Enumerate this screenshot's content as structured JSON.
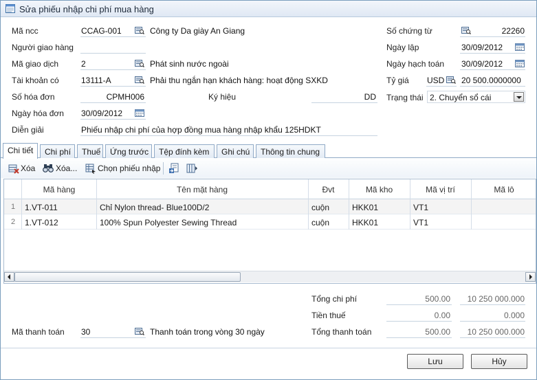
{
  "window": {
    "title": "Sửa phiếu nhập chi phí mua hàng"
  },
  "form": {
    "supplier_code_label": "Mã ncc",
    "supplier_code": "CCAG-001",
    "supplier_name": "Công ty Da giày An Giang",
    "deliverer_label": "Người giao hàng",
    "deliverer": "",
    "transaction_code_label": "Mã giao dịch",
    "transaction_code": "2",
    "transaction_name": "Phát sinh nước ngoài",
    "credit_account_label": "Tài khoản có",
    "credit_account": "13111-A",
    "credit_account_name": "Phải thu ngắn hạn khách hàng: hoạt động SXKD",
    "invoice_no_label": "Số hóa đơn",
    "invoice_no": "CPMH006",
    "symbol_label": "Ký hiệu",
    "symbol": "DD",
    "invoice_date_label": "Ngày hóa đơn",
    "invoice_date": "30/09/2012",
    "description_label": "Diễn giải",
    "description": "Phiếu nhập chi phí của hợp đồng mua hàng nhập khẩu 125HDKT",
    "voucher_no_label": "Số chứng từ",
    "voucher_no": "22260",
    "created_date_label": "Ngày lập",
    "created_date": "30/09/2012",
    "posting_date_label": "Ngày hạch toán",
    "posting_date": "30/09/2012",
    "exchange_rate_label": "Tỷ giá",
    "currency": "USD",
    "exchange_rate": "20 500.0000000",
    "status_label": "Trạng thái",
    "status": "2. Chuyển sổ cái"
  },
  "tabs": [
    {
      "label": "Chi tiết"
    },
    {
      "label": "Chi phí"
    },
    {
      "label": "Thuế"
    },
    {
      "label": "Ứng trước"
    },
    {
      "label": "Tệp đính kèm"
    },
    {
      "label": "Ghi chú"
    },
    {
      "label": "Thông tin chung"
    }
  ],
  "toolbar": {
    "delete_label": "Xóa",
    "delete_all_label": "Xóa...",
    "select_receipt_label": "Chọn phiếu nhập"
  },
  "grid": {
    "columns": [
      "Mã hàng",
      "Tên mặt hàng",
      "Đvt",
      "Mã kho",
      "Mã vị trí",
      "Mã lô"
    ],
    "rows": [
      {
        "num": "1",
        "code": "1.VT-011",
        "name": "Chỉ Nylon thread- Blue100D/2",
        "unit": "cuộn",
        "warehouse": "HKK01",
        "location": "VT1",
        "lot": ""
      },
      {
        "num": "2",
        "code": "1.VT-012",
        "name": "100% Spun Polyester Sewing Thread",
        "unit": "cuộn",
        "warehouse": "HKK01",
        "location": "VT1",
        "lot": ""
      }
    ]
  },
  "totals": {
    "total_cost_label": "Tổng chi phí",
    "total_cost_fc": "500.00",
    "total_cost": "10 250 000.000",
    "tax_label": "Tiền thuế",
    "tax_fc": "0.00",
    "tax": "0.000",
    "total_payment_label": "Tổng thanh toán",
    "total_payment_fc": "500.00",
    "total_payment": "10 250 000.000"
  },
  "payment": {
    "payment_code_label": "Mã thanh toán",
    "payment_code": "30",
    "payment_name": "Thanh toán trong vòng 30 ngày"
  },
  "buttons": {
    "save": "Lưu",
    "cancel": "Hủy"
  }
}
